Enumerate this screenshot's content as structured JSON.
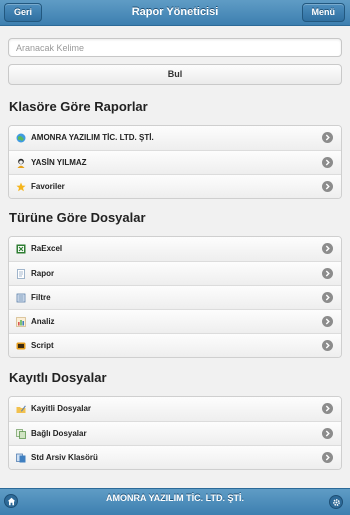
{
  "header": {
    "title": "Rapor Yöneticisi",
    "back_label": "Geri",
    "menu_label": "Menü"
  },
  "search": {
    "placeholder": "Aranacak Kelime",
    "button_label": "Bul"
  },
  "sections": [
    {
      "title": "Klasöre Göre Raporlar",
      "items": [
        {
          "label": "AMONRA YAZILIM TİC. LTD. ŞTİ.",
          "icon": "globe-icon"
        },
        {
          "label": "YASİN YILMAZ",
          "icon": "user-icon"
        },
        {
          "label": "Favoriler",
          "icon": "star-icon"
        }
      ]
    },
    {
      "title": "Türüne Göre Dosyalar",
      "items": [
        {
          "label": "RaExcel",
          "icon": "excel-icon"
        },
        {
          "label": "Rapor",
          "icon": "report-icon"
        },
        {
          "label": "Filtre",
          "icon": "filter-icon"
        },
        {
          "label": "Analiz",
          "icon": "chart-icon"
        },
        {
          "label": "Script",
          "icon": "script-icon"
        }
      ]
    },
    {
      "title": "Kayıtlı Dosyalar",
      "items": [
        {
          "label": "Kayitli Dosyalar",
          "icon": "folder-pencil-icon"
        },
        {
          "label": "Bağlı Dosyalar",
          "icon": "linked-files-icon"
        },
        {
          "label": "Std Arsiv Klasörü",
          "icon": "archive-icon"
        }
      ]
    }
  ],
  "footer": {
    "title": "AMONRA YAZILIM TİC. LTD. ŞTİ."
  }
}
